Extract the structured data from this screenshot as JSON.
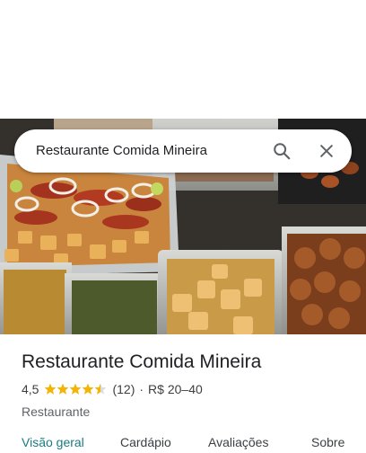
{
  "search": {
    "query": "Restaurante Comida Mineira"
  },
  "place": {
    "name": "Restaurante Comida Mineira",
    "rating": "4,5",
    "stars": 4.5,
    "review_count": "(12)",
    "separator": "·",
    "price": "R$ 20–40",
    "category": "Restaurante"
  },
  "tabs": [
    {
      "label": "Visão geral"
    },
    {
      "label": "Cardápio"
    },
    {
      "label": "Avaliações"
    },
    {
      "label": "Sobre"
    }
  ],
  "colors": {
    "accent": "#1b7a83",
    "star": "#f5b400",
    "text": "#202124"
  },
  "icons": [
    "search-icon",
    "close-icon",
    "star-icon"
  ]
}
